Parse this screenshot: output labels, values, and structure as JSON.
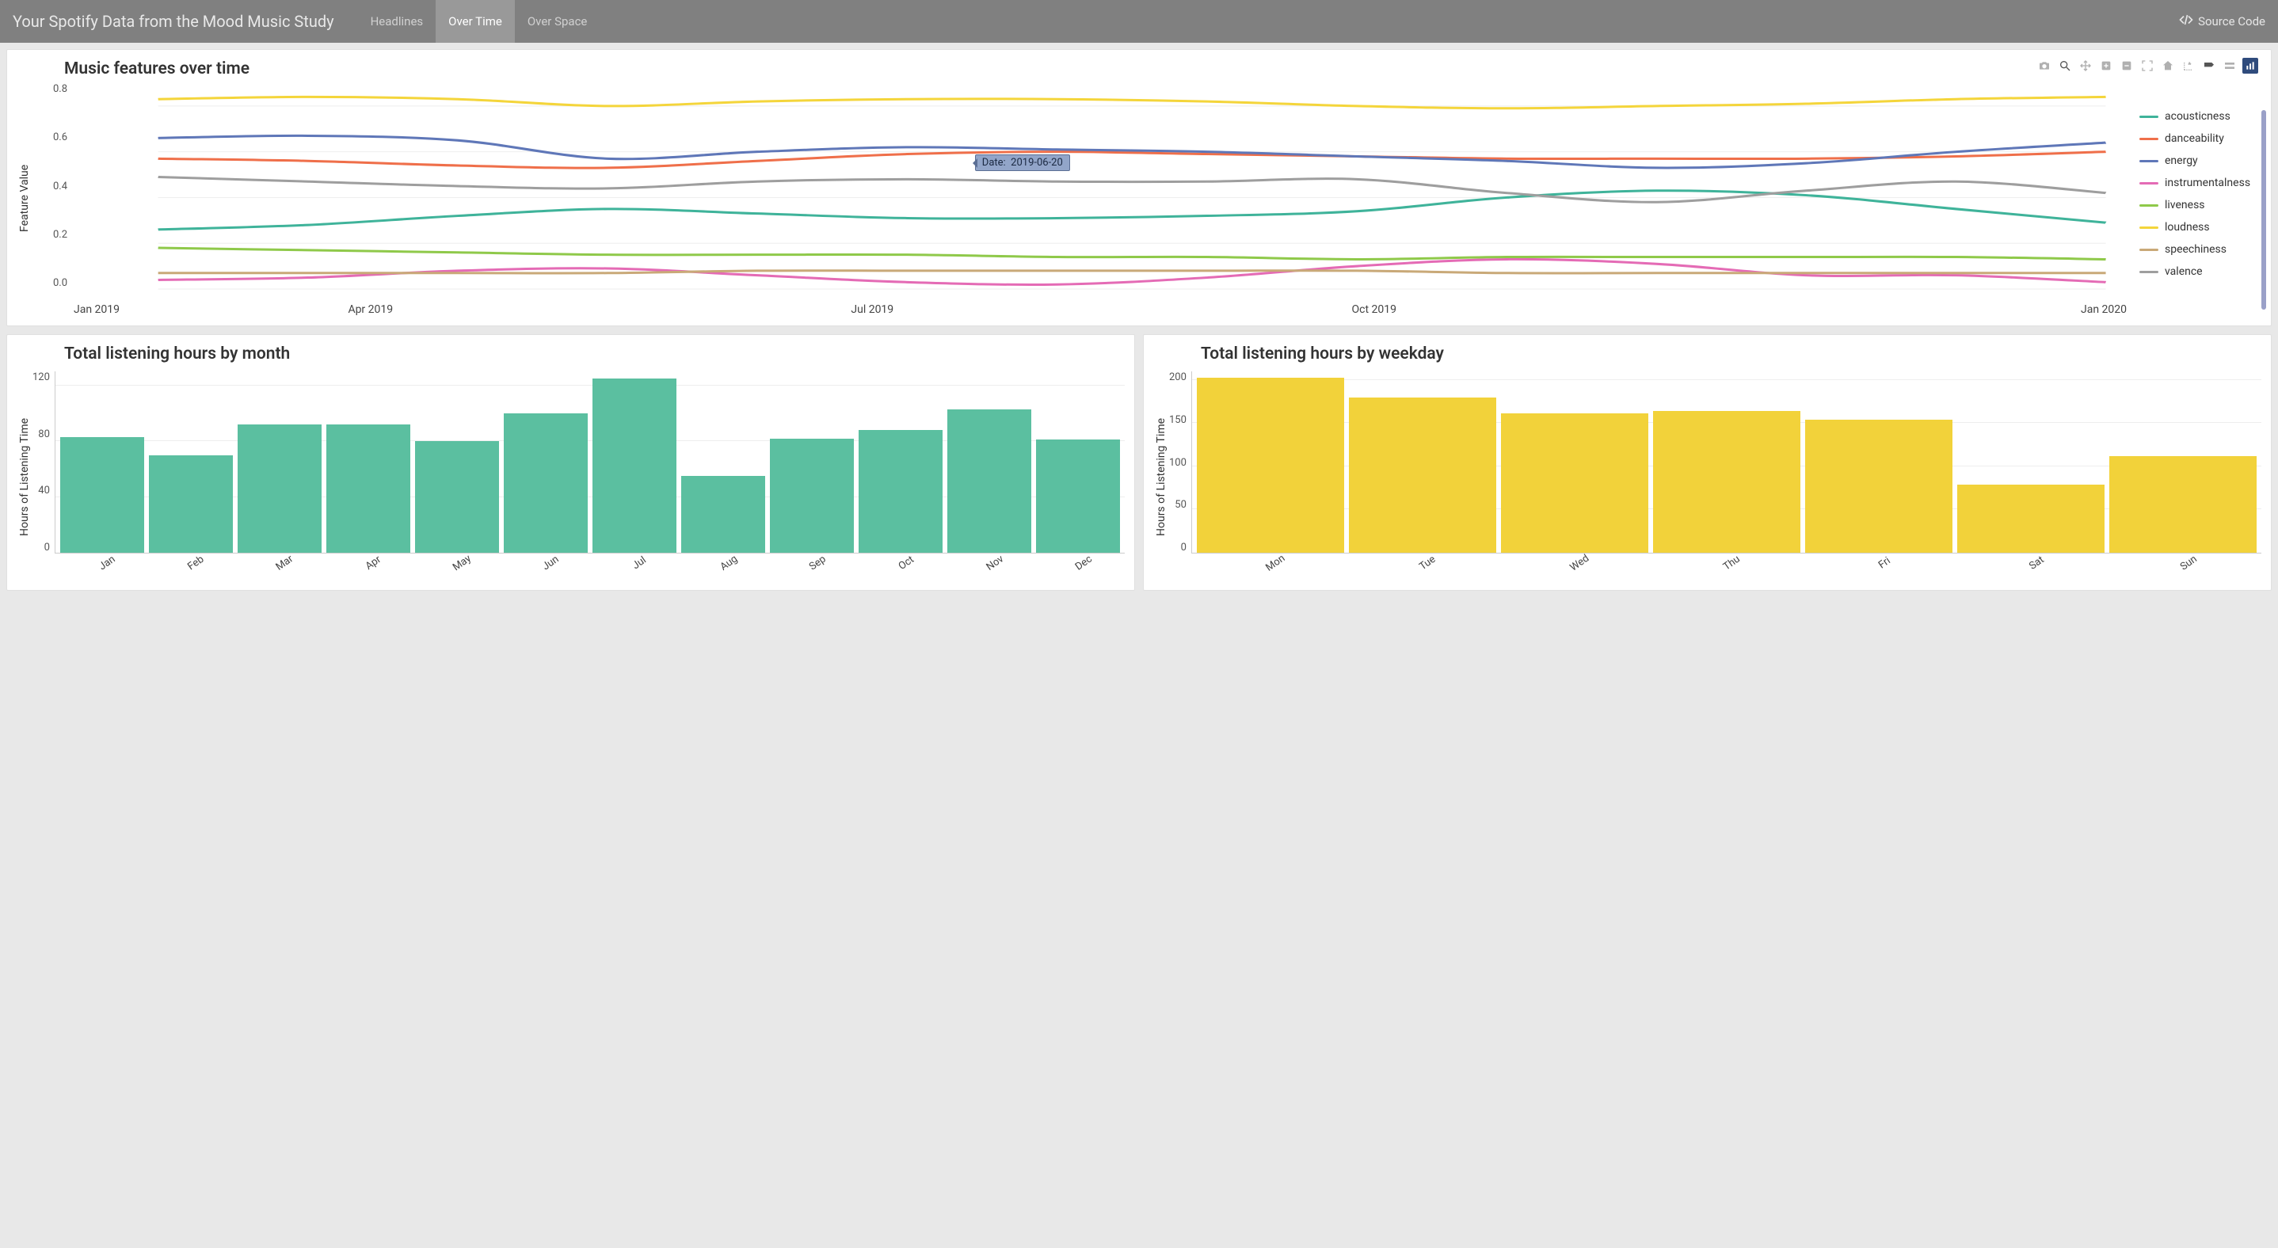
{
  "navbar": {
    "title": "Your Spotify Data from the Mood Music Study",
    "tabs": [
      {
        "label": "Headlines",
        "active": false
      },
      {
        "label": "Over Time",
        "active": true
      },
      {
        "label": "Over Space",
        "active": false
      }
    ],
    "source_label": "Source Code"
  },
  "line_chart": {
    "title": "Music features over time",
    "ylabel": "Feature Value",
    "tooltip": {
      "label": "Date:",
      "value": "2019-06-20"
    },
    "yticks": [
      "0.0",
      "0.2",
      "0.4",
      "0.6",
      "0.8"
    ],
    "xticks": [
      "Jan 2019",
      "Apr 2019",
      "Jul 2019",
      "Oct 2019",
      "Jan 2020"
    ],
    "legend": [
      {
        "name": "acousticness",
        "color": "#3fb39a"
      },
      {
        "name": "danceability",
        "color": "#ef6f4a"
      },
      {
        "name": "energy",
        "color": "#5f77b8"
      },
      {
        "name": "instrumentalness",
        "color": "#e46bb5"
      },
      {
        "name": "liveness",
        "color": "#8fc94a"
      },
      {
        "name": "loudness",
        "color": "#f4d53b"
      },
      {
        "name": "speechiness",
        "color": "#c9a978"
      },
      {
        "name": "valence",
        "color": "#9e9e9e"
      }
    ]
  },
  "month_chart": {
    "title": "Total listening hours by month",
    "ylabel": "Hours of Listening Time",
    "yticks": [
      "0",
      "40",
      "80",
      "120"
    ],
    "color": "#5bbfa0"
  },
  "weekday_chart": {
    "title": "Total listening hours by weekday",
    "ylabel": "Hours of Listening Time",
    "yticks": [
      "0",
      "50",
      "100",
      "150",
      "200"
    ],
    "color": "#f2d23a"
  },
  "chart_data": [
    {
      "type": "line",
      "title": "Music features over time",
      "xlabel": "",
      "ylabel": "Feature Value",
      "ylim": [
        0.0,
        0.9
      ],
      "x": [
        "2019-01",
        "2019-02",
        "2019-03",
        "2019-04",
        "2019-05",
        "2019-06",
        "2019-07",
        "2019-08",
        "2019-09",
        "2019-10",
        "2019-11",
        "2019-12",
        "2020-01",
        "2020-02"
      ],
      "series": [
        {
          "name": "acousticness",
          "color": "#3fb39a",
          "values": [
            0.26,
            0.28,
            0.32,
            0.35,
            0.33,
            0.31,
            0.31,
            0.32,
            0.34,
            0.4,
            0.43,
            0.41,
            0.35,
            0.29
          ]
        },
        {
          "name": "danceability",
          "color": "#ef6f4a",
          "values": [
            0.57,
            0.56,
            0.54,
            0.53,
            0.56,
            0.59,
            0.6,
            0.59,
            0.58,
            0.57,
            0.57,
            0.57,
            0.58,
            0.6
          ]
        },
        {
          "name": "energy",
          "color": "#5f77b8",
          "values": [
            0.66,
            0.67,
            0.65,
            0.57,
            0.6,
            0.62,
            0.61,
            0.6,
            0.58,
            0.56,
            0.53,
            0.55,
            0.6,
            0.64
          ]
        },
        {
          "name": "instrumentalness",
          "color": "#e46bb5",
          "values": [
            0.04,
            0.05,
            0.08,
            0.09,
            0.06,
            0.03,
            0.02,
            0.05,
            0.1,
            0.13,
            0.11,
            0.06,
            0.06,
            0.03
          ]
        },
        {
          "name": "liveness",
          "color": "#8fc94a",
          "values": [
            0.18,
            0.17,
            0.16,
            0.15,
            0.15,
            0.15,
            0.14,
            0.14,
            0.13,
            0.14,
            0.14,
            0.14,
            0.14,
            0.13
          ]
        },
        {
          "name": "loudness",
          "color": "#f4d53b",
          "values": [
            0.83,
            0.84,
            0.83,
            0.8,
            0.82,
            0.83,
            0.83,
            0.82,
            0.8,
            0.79,
            0.8,
            0.81,
            0.83,
            0.84
          ]
        },
        {
          "name": "speechiness",
          "color": "#c9a978",
          "values": [
            0.07,
            0.07,
            0.07,
            0.07,
            0.08,
            0.08,
            0.08,
            0.08,
            0.08,
            0.07,
            0.07,
            0.07,
            0.07,
            0.07
          ]
        },
        {
          "name": "valence",
          "color": "#9e9e9e",
          "values": [
            0.49,
            0.47,
            0.45,
            0.44,
            0.47,
            0.48,
            0.47,
            0.47,
            0.48,
            0.42,
            0.38,
            0.43,
            0.47,
            0.42
          ]
        }
      ]
    },
    {
      "type": "bar",
      "title": "Total listening hours by month",
      "ylabel": "Hours of Listening Time",
      "ylim": [
        0,
        130
      ],
      "categories": [
        "Jan",
        "Feb",
        "Mar",
        "Apr",
        "May",
        "Jun",
        "Jul",
        "Aug",
        "Sep",
        "Oct",
        "Nov",
        "Dec"
      ],
      "values": [
        83,
        70,
        92,
        92,
        80,
        100,
        125,
        55,
        82,
        88,
        103,
        81
      ]
    },
    {
      "type": "bar",
      "title": "Total listening hours by weekday",
      "ylabel": "Hours of Listening Time",
      "ylim": [
        0,
        210
      ],
      "categories": [
        "Mon",
        "Tue",
        "Wed",
        "Thu",
        "Fri",
        "Sat",
        "Sun"
      ],
      "values": [
        203,
        180,
        161,
        164,
        154,
        79,
        112
      ]
    }
  ]
}
